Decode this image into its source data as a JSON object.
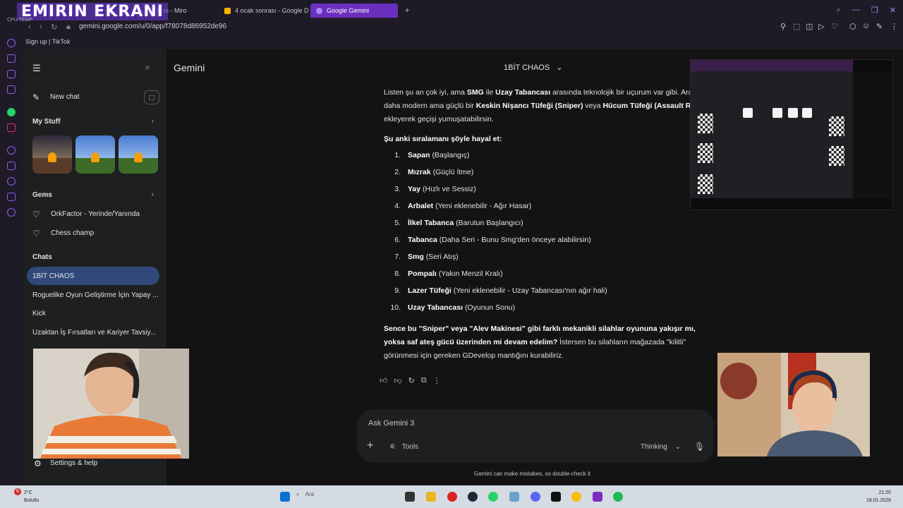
{
  "overlay": {
    "stream_title": "EMIRIN EKRANI"
  },
  "browser": {
    "cpu_label": "CPU TEMP",
    "tabs": [
      {
        "label": "Chaos - Miro",
        "icon": "miro-icon"
      },
      {
        "label": "4 ocak sonrası - Google D",
        "icon": "google-drive-icon"
      },
      {
        "label": "Google Gemini",
        "icon": "gemini-icon"
      }
    ],
    "url": "gemini.google.com/u/0/app/f78078d86952de96",
    "bookmark": "Sign up | TikTok"
  },
  "sidebar": {
    "new_chat": "New chat",
    "my_stuff": "My Stuff",
    "gems_header": "Gems",
    "gems": [
      "OrkFactor - Yerinde/Yanında",
      "Chess champ"
    ],
    "chats_header": "Chats",
    "chats": [
      "1BİT CHAOS",
      "Roguelike Oyun Geliştirme İçin Yapay ...",
      "Kick",
      "Uzaktan İş Fırsatları ve Kariyer Tavsiy..."
    ],
    "settings": "Settings & help"
  },
  "main": {
    "app_title": "Gemini",
    "chat_title": "1BİT CHAOS",
    "intro": {
      "t1": "Listen şu an çok iyi, ama ",
      "b1": "SMG",
      "t2": " ile ",
      "b2": "Uzay Tabancası",
      "t3": " arasında teknolojik bir uçurum var gibi. Araya daha modern ama güçlü bir ",
      "b3": "Keskin Nişancı Tüfeği (Sniper)",
      "t4": " veya ",
      "b4": "Hücum Tüfeği (Assault Rifle)",
      "t5": " ekleyerek geçişi yumuşatabilirsin."
    },
    "list_heading": "Şu anki sıralamanı şöyle hayal et:",
    "list": [
      {
        "num": "1.",
        "name": "Sapan",
        "desc": "(Başlangıç)"
      },
      {
        "num": "2.",
        "name": "Mızrak",
        "desc": "(Güçlü İtme)"
      },
      {
        "num": "3.",
        "name": "Yay",
        "desc": "(Hızlı ve Sessiz)"
      },
      {
        "num": "4.",
        "name": "Arbalet",
        "desc": "(Yeni eklenebilir - Ağır Hasar)"
      },
      {
        "num": "5.",
        "name": "İlkel Tabanca",
        "desc": "(Barutun Başlangıcı)"
      },
      {
        "num": "6.",
        "name": "Tabanca",
        "desc": "(Daha Seri - Bunu Smg'den önceye alabilirsin)"
      },
      {
        "num": "7.",
        "name": "Smg",
        "desc": "(Seri Atış)"
      },
      {
        "num": "8.",
        "name": "Pompalı",
        "desc": "(Yakın Menzil Kralı)"
      },
      {
        "num": "9.",
        "name": "Lazer Tüfeği",
        "desc": "(Yeni eklenebilir - Uzay Tabancası'nın ağır hali)"
      },
      {
        "num": "10.",
        "name": "Uzay Tabancası",
        "desc": "(Oyunun Sonu)"
      }
    ],
    "closing": {
      "b1": "Sence bu \"Sniper\" veya \"Alev Makinesi\" gibi farklı mekanikli silahlar oyununa yakışır mı, yoksa saf ateş gücü üzerinden mi devam edelim?",
      "t1": " İstersen bu silahların mağazada \"kilitli\" görünmesi için gereken GDevelop mantığını kurabiliriz."
    },
    "input_placeholder": "Ask Gemini 3",
    "tools_label": "Tools",
    "mode_label": "Thinking",
    "disclaimer": "Gemini can make mistakes, so double-check it"
  },
  "taskbar": {
    "weather_temp": "2°C",
    "weather_desc": "Bulutlu",
    "notif_count": "6",
    "search": "Ara",
    "time": "21:20",
    "date": "18.01.2026"
  },
  "colors": {
    "accent": "#6b2fbf",
    "active_chat": "#2f4a7a",
    "bg": "#131314",
    "sidebar": "#1e1f20"
  }
}
